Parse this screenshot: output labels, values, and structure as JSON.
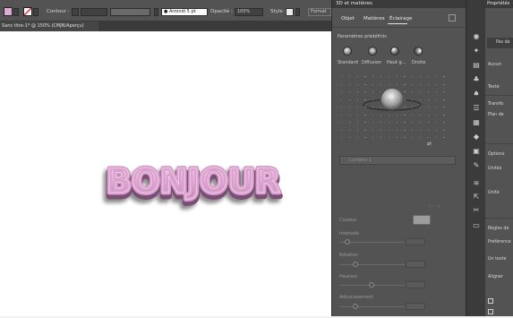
{
  "control_bar": {
    "fill_color": "#e3a9d6",
    "stroke_label": "Contour :",
    "font_name": "Arrondi",
    "font_size": "5 pt",
    "opacity_label": "Opacité :",
    "opacity_value": "100%",
    "style_label": "Style :",
    "format_button": "Format"
  },
  "document_tab": {
    "title": "Sans titre-1* @ 150% (CMJN/Aperçu)"
  },
  "canvas": {
    "artwork_text": "BONJOUR",
    "text_color": "#e7b1dc"
  },
  "panel_3d": {
    "title": "3D et matières",
    "tabs": [
      "Objet",
      "Matières",
      "Éclairage"
    ],
    "presets_label": "Paramètres prédéfinis",
    "presets": [
      "Standard",
      "Diffusion",
      "Haut g...",
      "Droite"
    ],
    "light_name": "Lumière 1",
    "color_label": "Couleur",
    "sliders": [
      {
        "label": "Intensité",
        "value": 0.12
      },
      {
        "label": "Rotation",
        "value": 0.24
      },
      {
        "label": "Hauteur",
        "value": 0.49
      },
      {
        "label": "Adoucissement",
        "value": 0.24
      }
    ]
  },
  "properties": {
    "title": "Propriétés",
    "texts": [
      "Pas de",
      "Aucun",
      "Texte",
      "Transfo",
      "Plan de",
      "Options",
      "Unités",
      "Unité",
      "Règles de",
      "Préférence",
      "Un texte",
      "Aligner"
    ]
  }
}
